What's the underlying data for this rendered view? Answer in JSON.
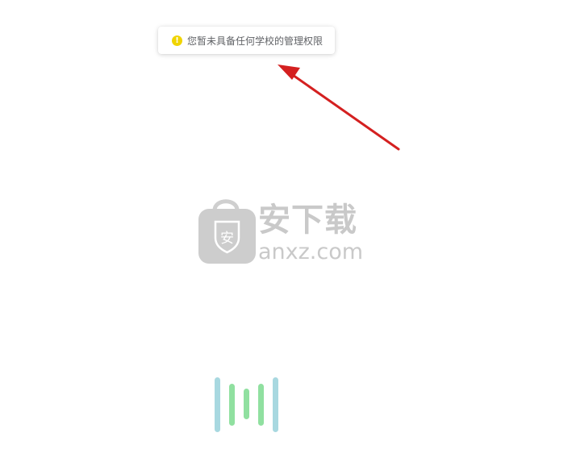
{
  "toast": {
    "message": "您暂未具备任何学校的管理权限",
    "icon": "warning-icon",
    "icon_glyph": "!",
    "icon_color": "#f0d400"
  },
  "annotation": {
    "icon": "red-arrow-icon",
    "color": "#d42020"
  },
  "watermark": {
    "icon": "shopping-bag-icon",
    "bag_glyph": "安",
    "title": "安下载",
    "domain": "anxz.com"
  },
  "loader": {
    "icon": "loading-bars-icon",
    "colors": [
      "#a8d8e0",
      "#90e0a0"
    ]
  }
}
